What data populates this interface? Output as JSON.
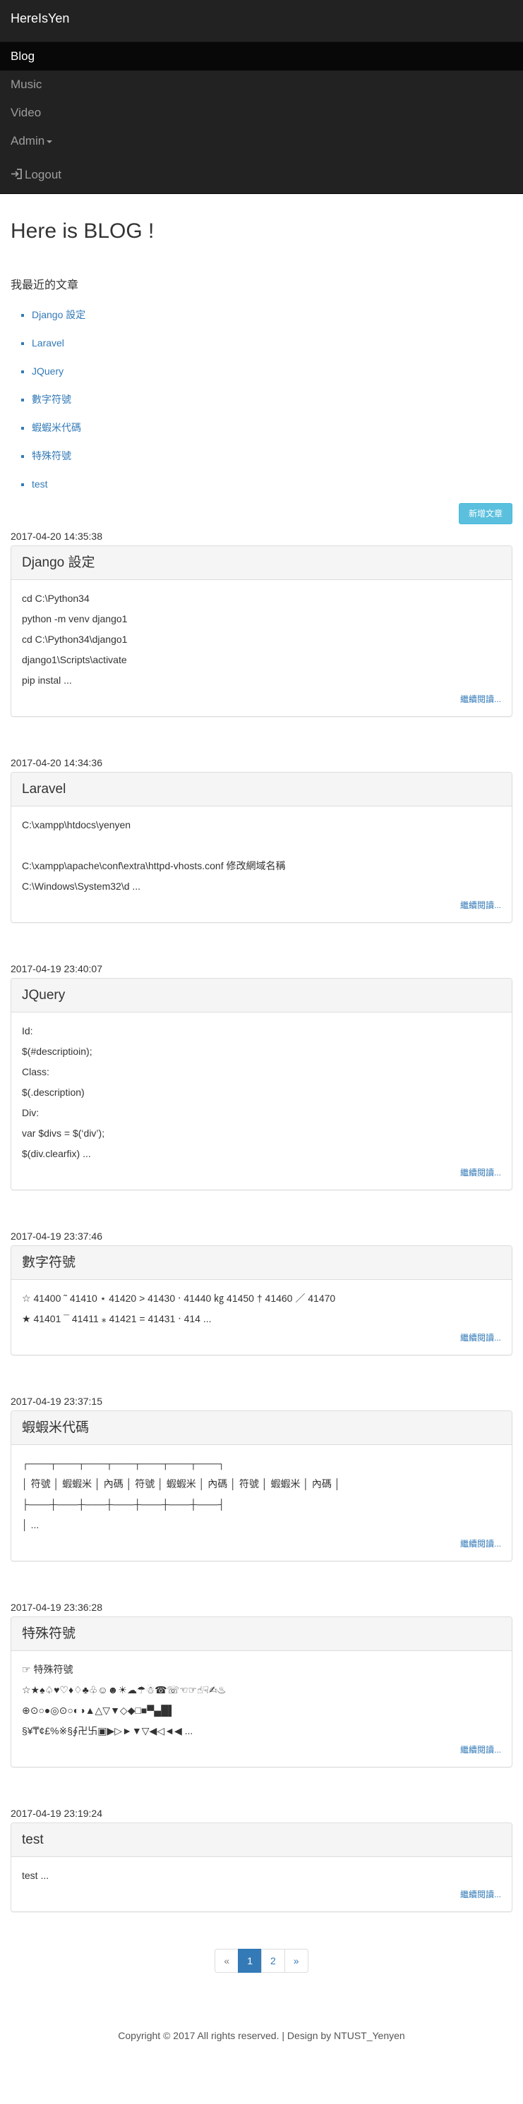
{
  "navbar": {
    "brand": "HereIsYen",
    "items": [
      {
        "label": "Blog",
        "active": true
      },
      {
        "label": "Music",
        "active": false
      },
      {
        "label": "Video",
        "active": false
      },
      {
        "label": "Admin",
        "active": false
      }
    ],
    "logout_label": "Logout"
  },
  "main": {
    "title": "Here is BLOG !",
    "recent_heading": "我最近的文章",
    "recent_links": [
      "Django 設定",
      "Laravel",
      "JQuery",
      "數字符號",
      "蝦蝦米代碼",
      "特殊符號",
      "test"
    ],
    "new_article_button": "新增文章"
  },
  "posts": [
    {
      "date": "2017-04-20 14:35:38",
      "title": "Django 設定",
      "lines": [
        "cd C:\\Python34",
        "python -m venv django1",
        "cd C:\\Python34\\django1",
        "django1\\Scripts\\activate",
        "pip instal ..."
      ],
      "read_more": "繼續閱讀..."
    },
    {
      "date": "2017-04-20 14:34:36",
      "title": "Laravel",
      "lines": [
        "C:\\xampp\\htdocs\\yenyen",
        "",
        "C:\\xampp\\apache\\conf\\extra\\httpd-vhosts.conf 修改網域名稱",
        "C:\\Windows\\System32\\d ..."
      ],
      "read_more": "繼續閱讀..."
    },
    {
      "date": "2017-04-19 23:40:07",
      "title": "JQuery",
      "lines": [
        "Id:",
        "$(#descriptioin);",
        "Class:",
        "$(.description)",
        "Div:",
        "var $divs = $(‘div’);",
        "$(div.clearfix) ..."
      ],
      "read_more": "繼續閱讀..."
    },
    {
      "date": "2017-04-19 23:37:46",
      "title": "數字符號",
      "lines": [
        "☆ 41400 ˜ 41410 ⋆ 41420 > 41430 ‧ 41440 ㎏ 41450 † 41460 ／ 41470",
        "★ 41401 ¯ 41411 ⁎ 41421 = 41431 ‧ 414 ..."
      ],
      "read_more": "繼續閱讀..."
    },
    {
      "date": "2017-04-19 23:37:15",
      "title": "蝦蝦米代碼",
      "lines": [
        "┌───┬───┬───┬───┬───┬───┬───┐",
        "│ 符號 │ 蝦蝦米 │ 內碼 │ 符號 │ 蝦蝦米 │ 內碼 │ 符號 │ 蝦蝦米 │ 內碼 │",
        "├───┼───┼───┼───┼───┼───┼───┤",
        "│ ..."
      ],
      "read_more": "繼續閱讀..."
    },
    {
      "date": "2017-04-19 23:36:28",
      "title": "特殊符號",
      "lines": [
        "☞ 特殊符號",
        "☆★♠♤♥♡♦♢♣♧☺☻☀☁☂☃☎☏☜☞☝☟✍♨",
        "⊕⊙○●◎⊙○◐◑▲△▽▼◇◆□■▀▄█▌",
        "§¥₸¢£%※§∮卍卐▣▶▷►▼▽◀◁◄◀ ..."
      ],
      "read_more": "繼續閱讀..."
    },
    {
      "date": "2017-04-19 23:19:24",
      "title": "test",
      "lines": [
        "test ..."
      ],
      "read_more": "繼續閱讀..."
    }
  ],
  "pagination": {
    "prev": "«",
    "pages": [
      "1",
      "2"
    ],
    "next": "»",
    "current": "1"
  },
  "footer": "Copyright © 2017 All rights reserved. | Design by NTUST_Yenyen",
  "colors": {
    "navbar_bg": "#222222",
    "link": "#337ab7",
    "info_button": "#5bc0de",
    "panel_heading": "#f5f5f5"
  }
}
